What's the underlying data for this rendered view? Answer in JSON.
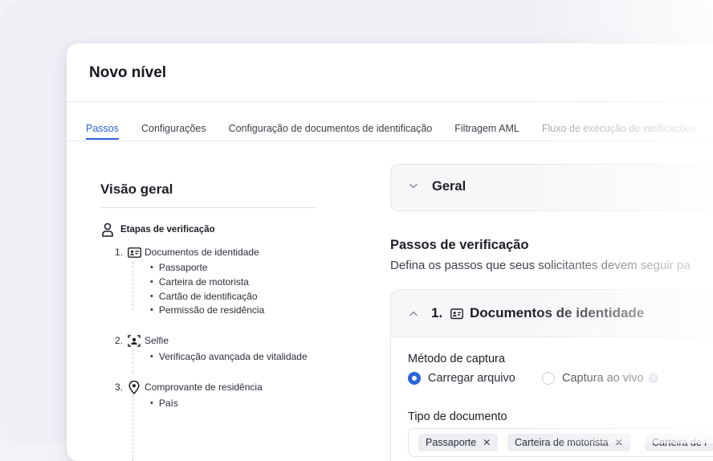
{
  "window": {
    "title": "Novo nível"
  },
  "tabs": [
    {
      "label": "Passos",
      "active": true
    },
    {
      "label": "Configurações"
    },
    {
      "label": "Configuração de documentos de identificação"
    },
    {
      "label": "Filtragem AML"
    },
    {
      "label": "Fluxo de execução de verificações"
    }
  ],
  "overview": {
    "title": "Visão geral",
    "heading": "Etapas de verificação",
    "steps": [
      {
        "number": "1.",
        "icon": "id-card-icon",
        "label": "Documentos de identidade",
        "items": [
          "Passaporte",
          "Carteira de motorista",
          "Cartão de identificação",
          "Permissão de residência"
        ]
      },
      {
        "number": "2.",
        "icon": "selfie-icon",
        "label": "Selfie",
        "items": [
          "Verificação avançada de vitalidade"
        ]
      },
      {
        "number": "3.",
        "icon": "location-pin-icon",
        "label": "Comprovante de residência",
        "items": [
          "País"
        ]
      }
    ]
  },
  "main": {
    "general_section": "Geral",
    "steps_title": "Passos de verificação",
    "steps_description": "Defina os passos que seus solicitantes devem seguir pa",
    "doc_section": {
      "number": "1.",
      "title": "Documentos de identidade",
      "capture_label": "Método de captura",
      "capture_options": [
        {
          "label": "Carregar arquivo",
          "selected": true
        },
        {
          "label": "Captura ao vivo",
          "selected": false
        }
      ],
      "doc_type_label": "Tipo de documento",
      "doc_type_tags": [
        "Passaporte",
        "Carteira de motorista",
        "Carteira de i"
      ]
    }
  },
  "colors": {
    "accent": "#2b63d9",
    "text": "#1c1f26",
    "muted": "#9aa0ac"
  }
}
